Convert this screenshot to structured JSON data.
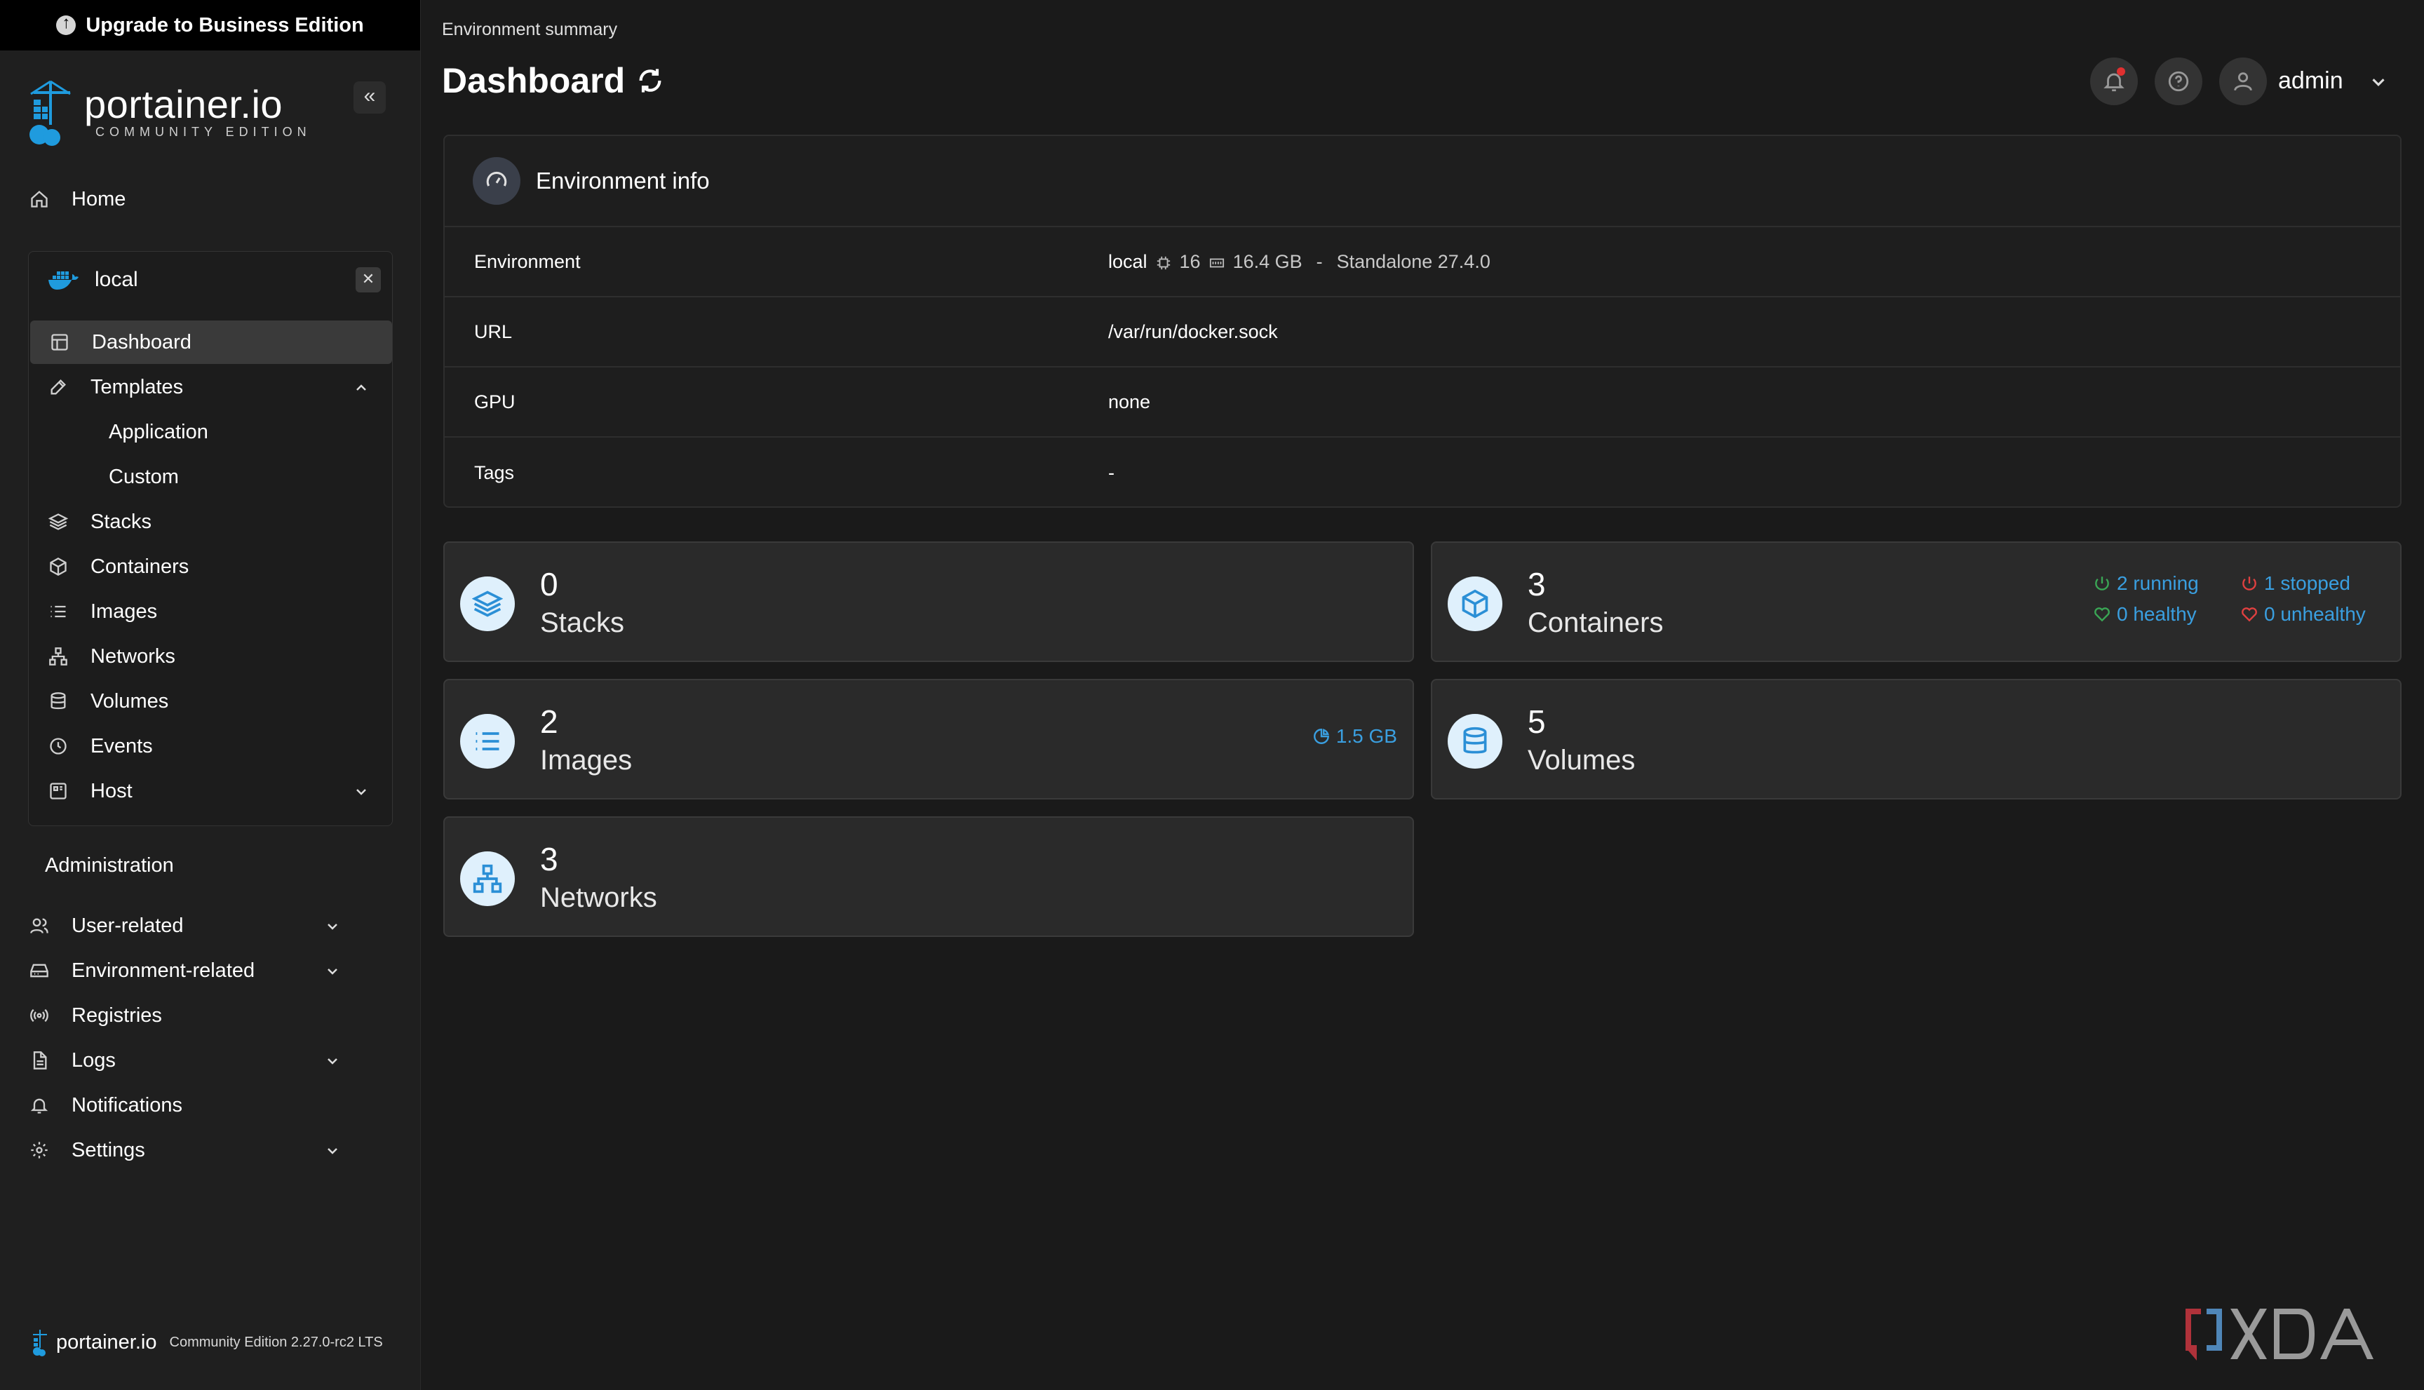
{
  "banner": {
    "label": "Upgrade to Business Edition"
  },
  "brand": {
    "name": "portainer.io",
    "edition": "COMMUNITY EDITION"
  },
  "sidebar": {
    "home": "Home",
    "environment": {
      "name": "local",
      "items": [
        {
          "label": "Dashboard",
          "active": true
        },
        {
          "label": "Templates",
          "expanded": true
        },
        {
          "label": "Application"
        },
        {
          "label": "Custom"
        },
        {
          "label": "Stacks"
        },
        {
          "label": "Containers"
        },
        {
          "label": "Images"
        },
        {
          "label": "Networks"
        },
        {
          "label": "Volumes"
        },
        {
          "label": "Events"
        },
        {
          "label": "Host"
        }
      ]
    },
    "admin_title": "Administration",
    "admin_items": [
      {
        "label": "User-related"
      },
      {
        "label": "Environment-related"
      },
      {
        "label": "Registries"
      },
      {
        "label": "Logs"
      },
      {
        "label": "Notifications"
      },
      {
        "label": "Settings"
      }
    ],
    "footer": {
      "name": "portainer.io",
      "version": "Community Edition 2.27.0-rc2 LTS"
    }
  },
  "header": {
    "breadcrumb": "Environment summary",
    "title": "Dashboard",
    "user": "admin"
  },
  "env_info": {
    "title": "Environment info",
    "rows": [
      {
        "label": "Environment",
        "name": "local",
        "cpu": "16",
        "memory": "16.4 GB",
        "sep": "-",
        "type": "Standalone 27.4.0"
      },
      {
        "label": "URL",
        "value": "/var/run/docker.sock"
      },
      {
        "label": "GPU",
        "value": "none"
      },
      {
        "label": "Tags",
        "value": "-"
      }
    ]
  },
  "cards": {
    "stacks": {
      "count": "0",
      "label": "Stacks"
    },
    "containers": {
      "count": "3",
      "label": "Containers",
      "running": "2 running",
      "stopped": "1 stopped",
      "healthy": "0 healthy",
      "unhealthy": "0 unhealthy"
    },
    "images": {
      "count": "2",
      "label": "Images",
      "size": "1.5 GB"
    },
    "volumes": {
      "count": "5",
      "label": "Volumes"
    },
    "networks": {
      "count": "3",
      "label": "Networks"
    }
  },
  "watermark": {
    "text": "XDA"
  },
  "colors": {
    "accent": "#2b8fd6",
    "running": "#3aa655",
    "stopped": "#e04040",
    "info": "#3a9fe0"
  }
}
